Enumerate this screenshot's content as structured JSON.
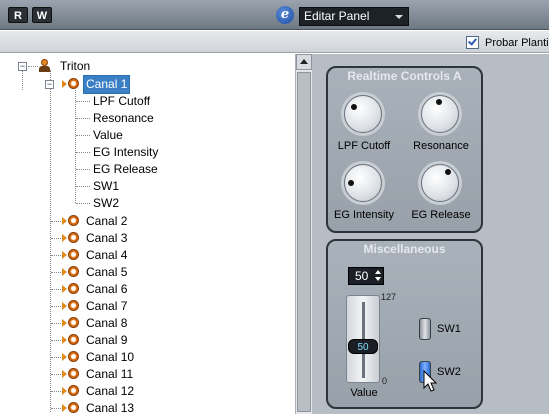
{
  "toolbar": {
    "btn_r": "R",
    "btn_w": "W",
    "edit_icon": "e-icon",
    "panel_select_value": "Editar Panel"
  },
  "options": {
    "test_template_label": "Probar Plantilla",
    "test_template_checked": true
  },
  "tree": {
    "root": "Triton",
    "channel1": "Canal 1",
    "params": [
      "LPF Cutoff",
      "Resonance",
      "Value",
      "EG Intensity",
      "EG Release",
      "SW1",
      "SW2"
    ],
    "channels": [
      "Canal 2",
      "Canal 3",
      "Canal 4",
      "Canal 5",
      "Canal 6",
      "Canal 7",
      "Canal 8",
      "Canal 9",
      "Canal 10",
      "Canal 11",
      "Canal 12",
      "Canal 13"
    ]
  },
  "realtime": {
    "title": "Realtime Controls A",
    "knobs": [
      "LPF Cutoff",
      "Resonance",
      "EG Intensity",
      "EG Release"
    ]
  },
  "misc": {
    "title": "Miscellaneous",
    "number_value": "50",
    "fader_value": "50",
    "fader_max": "127",
    "fader_min": "0",
    "fader_label": "Value",
    "sw1_label": "SW1",
    "sw1_on": false,
    "sw2_label": "SW2",
    "sw2_on": true
  },
  "colors": {
    "toolbar": "#7d8691",
    "panel_bg": "#b6bdc5",
    "group_border": "#2f343b",
    "switch_on": "#3a7ae0",
    "tree_icon": "#e08a1e"
  }
}
